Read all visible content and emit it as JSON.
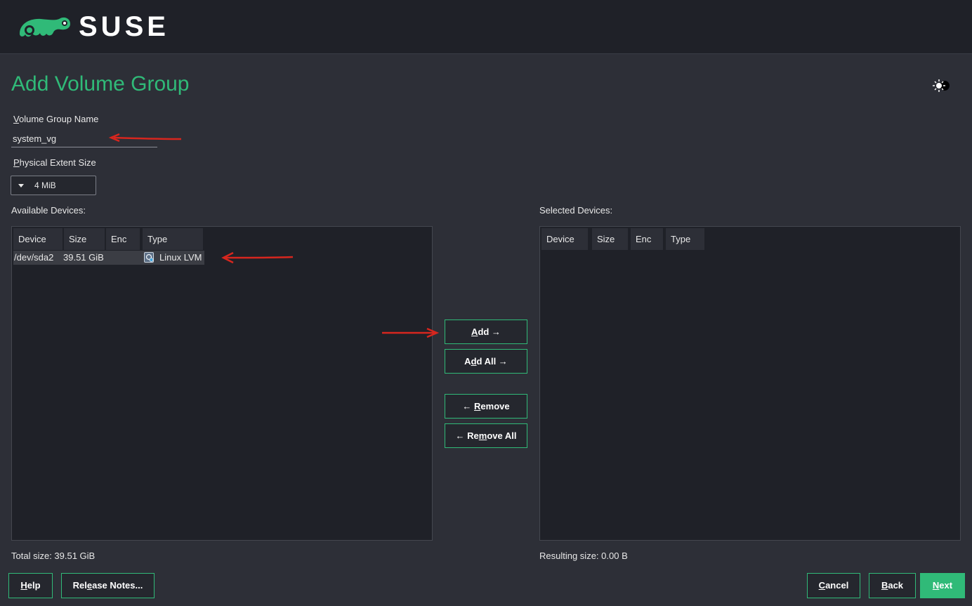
{
  "header": {
    "brand": "SUSE"
  },
  "page": {
    "title": "Add Volume Group"
  },
  "form": {
    "vg_name_label_mnemonic": "V",
    "vg_name_label_rest": "olume Group Name",
    "vg_name_value": "system_vg",
    "extent_label_mnemonic": "P",
    "extent_label_rest": "hysical Extent Size",
    "extent_value": "4 MiB"
  },
  "available": {
    "label": "Available Devices:",
    "columns": [
      "Device",
      "Size",
      "Enc",
      "Type"
    ],
    "rows": [
      {
        "device": "/dev/sda2",
        "size": "39.51 GiB",
        "enc": "",
        "type": "Linux LVM",
        "icon": "disk-lvm-icon"
      }
    ],
    "total": "Total size: 39.51 GiB"
  },
  "selected": {
    "label": "Selected Devices:",
    "columns": [
      "Device",
      "Size",
      "Enc",
      "Type"
    ],
    "resulting": "Resulting size: 0.00 B"
  },
  "actions": {
    "add": {
      "mnemonic": "A",
      "rest": "dd →"
    },
    "add_all": {
      "pre": "A",
      "mnemonic": "d",
      "rest": "d All →"
    },
    "remove": {
      "pre": "← ",
      "mnemonic": "R",
      "rest": "emove"
    },
    "remove_all": {
      "pre": "← Re",
      "mnemonic": "m",
      "rest": "ove All"
    }
  },
  "footer": {
    "help": {
      "mnemonic": "H",
      "rest": "elp"
    },
    "release_notes": {
      "pre": "Rel",
      "mnemonic": "e",
      "rest": "ase Notes..."
    },
    "cancel": {
      "mnemonic": "C",
      "rest": "ancel"
    },
    "back": {
      "mnemonic": "B",
      "rest": "ack"
    },
    "next": {
      "mnemonic": "N",
      "rest": "ext"
    }
  },
  "colors": {
    "accent": "#30ba78",
    "background": "#2d2f37",
    "topbar": "#1f2128",
    "annotation": "#d7261e"
  }
}
